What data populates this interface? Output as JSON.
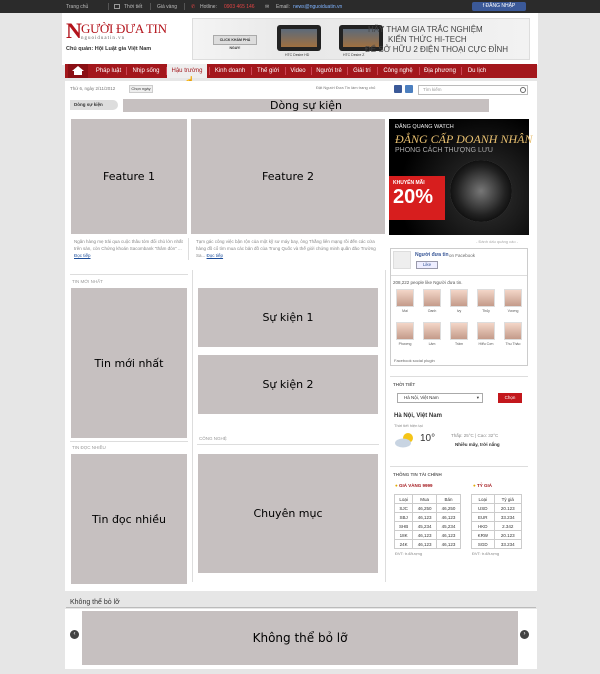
{
  "topbar": {
    "home": "Trang chủ",
    "weather": "Thời tiết",
    "gold": "Giá vàng",
    "hotline_label": "Hotline:",
    "hotline": "0903 465 146",
    "email_label": "Email:",
    "email": "news@nguoiduatin.vn",
    "fb_login": "ĐĂNG NHẬP"
  },
  "logo": {
    "initial": "N",
    "rest": "GƯỜI ĐƯA TIN",
    "sub": "nguoiduatin.vn",
    "owner": "Chủ quản: Hội Luật gia Việt Nam"
  },
  "banner": {
    "cta": "CLICK KHÁM PHÁ NGAY!",
    "car1": "HTC Desire HD",
    "car2": "HTC Desire Z",
    "line1": "HÃY THAM GIA TRẮC NGHIỆM",
    "line2": "KIẾN THỨC HI-TECH",
    "line3": "ĐỂ SỞ HỮU 2 ĐIỆN THOẠI CỰC ĐỈNH"
  },
  "nav": {
    "items": [
      "Pháp luật",
      "Nhịp sống",
      "Hậu trường",
      "Kinh doanh",
      "Thế giới",
      "Video",
      "Người trẻ",
      "Giải trí",
      "Công nghệ",
      "Địa phương",
      "Du lịch"
    ]
  },
  "toolbar": {
    "date": "Thứ 6, ngày 2/11/2012",
    "date_button": "Chọn ngày",
    "slogan": "Đặt Người Đưa Tin làm trang chủ",
    "search_placeholder": "Tìm kiếm"
  },
  "events": {
    "label": "Dòng sự kiện",
    "breaking": "Dòng sự kiện"
  },
  "features": {
    "f1": "Feature 1",
    "f2": "Feature 2",
    "desc1": "Ngân hàng mẹ trải qua cuộc thâu tóm đổi chủ lớn nhất trên sàn, còn Chứng khoán Sacombank \"thâm đòn\" ...",
    "desc2": "Tạm gác công việc bận rộn của một kỹ sư máy bay, ông Thắng liên mạng rồi đến các cửa hàng đồ cổ tìm mua các bản đồ của Trung Quốc và thế giới chứng minh quần đảo Trường Sa...",
    "more": "Đọc tiếp"
  },
  "sections": {
    "latest_label": "TIN MỚI NHẤT",
    "latest": "Tin mới nhất",
    "popular_label": "TIN ĐỌC NHIỀU",
    "popular": "Tin đọc nhiều",
    "event1": "Sự kiện 1",
    "event2": "Sự kiện 2",
    "tech_label": "CÔNG NGHỆ",
    "category": "Chuyên mục"
  },
  "ad": {
    "brand": "ĐĂNG QUANG WATCH",
    "headline": "ĐẲNG CẤP DOANH NHÂN",
    "tagline": "PHONG CÁCH THƯỢNG LƯU",
    "promo_label": "KHUYẾN MÃI",
    "promo_value": "20%",
    "note": "- Đánh dấu quảng cáo -"
  },
  "facebook": {
    "name": "Người đưa tin",
    "on": "on Facebook",
    "like": "Like",
    "count": "208,222 people like Người đưa tin.",
    "fans": [
      "Mai",
      "Oanh",
      "Ivy",
      "Thủy",
      "Vương",
      "Phương",
      "Lâm",
      "Trâm",
      "Hiểu Cơn",
      "Thu Thảo"
    ],
    "plugin": "Facebook social plugin"
  },
  "weather": {
    "label": "THỜI TIẾT",
    "location": "Hà Nội, Việt Nam",
    "button": "Chọn",
    "city": "Hà Nội, Việt Nam",
    "now": "Thời tiết hiện tại",
    "temp": "10°",
    "range": "Thấp: 25°C  |  Cao: 32°C",
    "desc": "Nhiều mây, trời nắng"
  },
  "finance": {
    "label": "THÔNG TIN TÀI CHÍNH",
    "gold_title": "GIÁ VÀNG 9999",
    "gold_headers": [
      "Loại",
      "Mua",
      "Bán"
    ],
    "gold_rows": [
      [
        "SJC",
        "46,250",
        "46,250"
      ],
      [
        "SBJ",
        "46,123",
        "46,123"
      ],
      [
        "SHB",
        "45,234",
        "45,234"
      ],
      [
        "18K",
        "46,123",
        "46,123"
      ],
      [
        "24K",
        "46,123",
        "46,123"
      ]
    ],
    "gold_src": "ĐVT: tr.đ/lượng",
    "fx_title": "TỶ GIÁ",
    "fx_headers": [
      "Loại",
      "Tỷ giá"
    ],
    "fx_rows": [
      [
        "USD",
        "20.123"
      ],
      [
        "EUR",
        "33.234"
      ],
      [
        "HKD",
        "2.342"
      ],
      [
        "KRW",
        "20.123"
      ],
      [
        "SGD",
        "33.234"
      ]
    ],
    "fx_src": "ĐVT: tr.đ/lượng"
  },
  "footer": {
    "label": "Không thể bỏ lỡ",
    "carousel": "Không thể bỏ lỡ"
  }
}
